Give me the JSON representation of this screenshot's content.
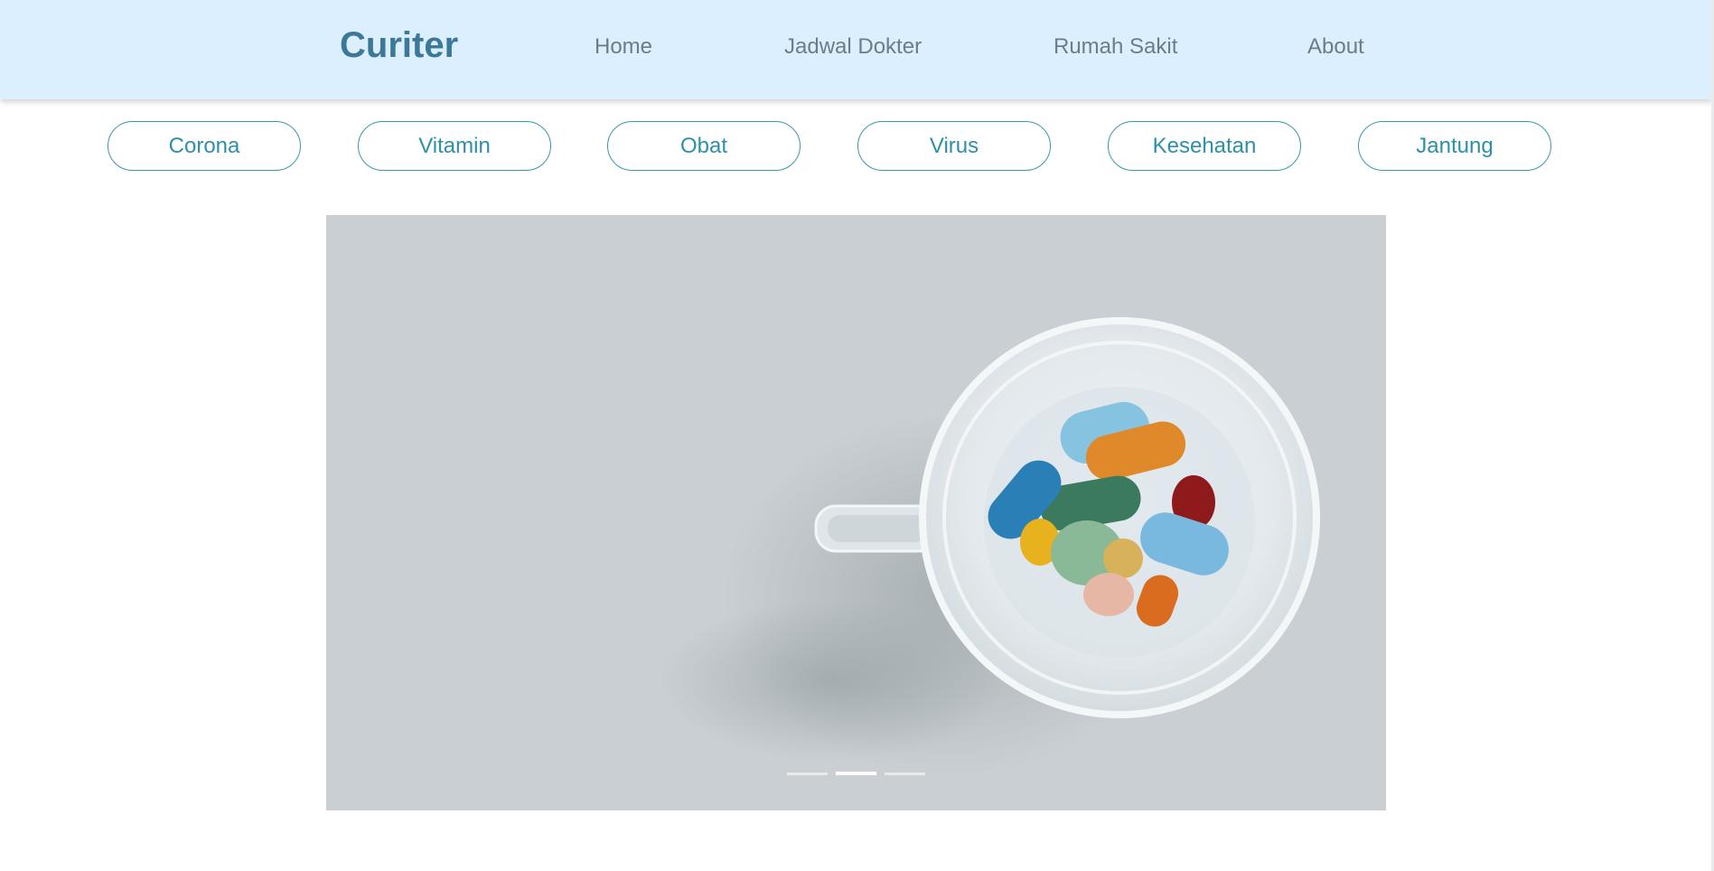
{
  "navbar": {
    "brand": "Curiter",
    "links": [
      "Home",
      "Jadwal Dokter",
      "Rumah Sakit",
      "About"
    ]
  },
  "categories": [
    "Corona",
    "Vitamin",
    "Obat",
    "Virus",
    "Kesehatan",
    "Jantung"
  ],
  "carousel": {
    "image_subject": "pills-in-glass-cup",
    "slide_count": 3,
    "active_slide": 2
  },
  "colors": {
    "navbar_bg": "#dcefff",
    "brand": "#3c7898",
    "nav_link": "#6d7c86",
    "chip_accent": "#2e90a8",
    "carousel_bg": "#c9cfd2"
  }
}
